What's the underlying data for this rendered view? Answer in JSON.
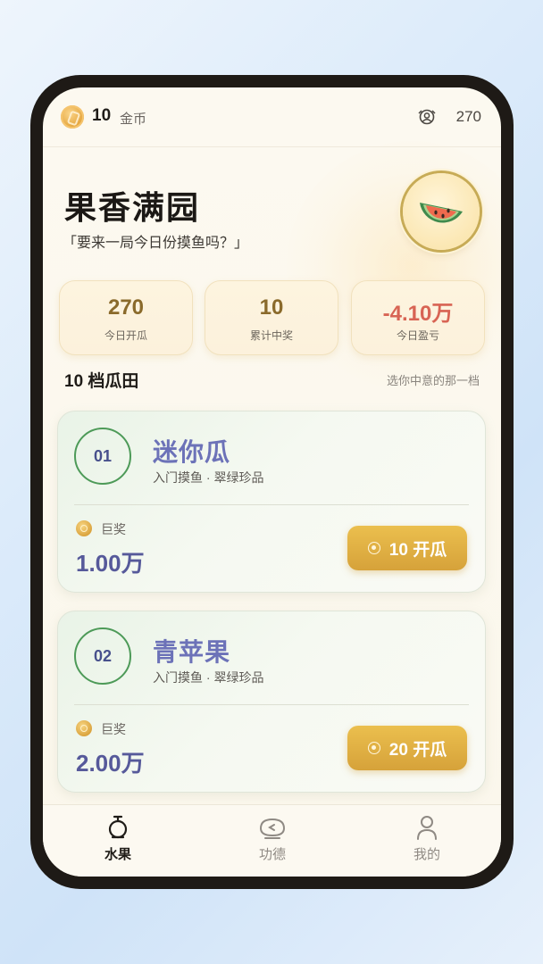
{
  "status": {
    "coin_amount": "10",
    "coin_unit": "金币",
    "online_count": "270"
  },
  "header": {
    "title": "果香满园",
    "subtitle": "「要来一局今日份摸鱼吗？」"
  },
  "stats": [
    {
      "value": "270",
      "label": "今日开瓜"
    },
    {
      "value": "10",
      "label": "累计中奖"
    },
    {
      "value": "-4.10万",
      "label": "今日盈亏"
    }
  ],
  "section": {
    "title": "10 档瓜田",
    "hint": "选你中意的那一档"
  },
  "tiers": [
    {
      "index": "01",
      "name": "迷你瓜",
      "desc": "入门摸鱼 · 翠绿珍品",
      "prize_label": "巨奖",
      "prize_amount": "1.00万",
      "button_label": "10 开瓜"
    },
    {
      "index": "02",
      "name": "青苹果",
      "desc": "入门摸鱼 · 翠绿珍品",
      "prize_label": "巨奖",
      "prize_amount": "2.00万",
      "button_label": "20 开瓜"
    }
  ],
  "tabs": [
    {
      "label": "水果",
      "icon": "fruit-icon",
      "active": true
    },
    {
      "label": "功德",
      "icon": "merit-icon",
      "active": false
    },
    {
      "label": "我的",
      "icon": "profile-icon",
      "active": false
    }
  ],
  "colors": {
    "accent_gold": "#d9a63e",
    "tier_name": "#6c72b8",
    "negative": "#d86454",
    "ring_green": "#4d9a58"
  }
}
